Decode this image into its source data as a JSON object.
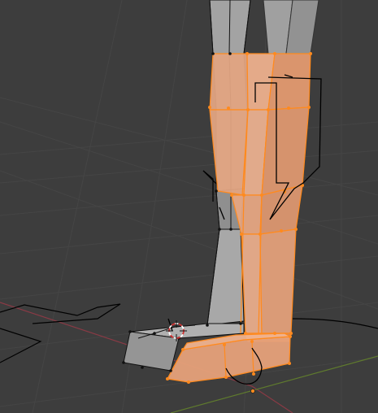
{
  "viewport": {
    "name": "3D Viewport",
    "colors": {
      "background": "#3d3d3d",
      "grid_line": "#454545",
      "axis_x": "#8a3a45",
      "axis_y": "#5f7a2e",
      "mesh_unselected_face": "#9c9c9c",
      "mesh_unselected_edge": "#111111",
      "mesh_selected_face": "#e7a57f",
      "mesh_selected_edge": "#ff8a1e",
      "vertex_selected": "#ff8a1e",
      "armature_line": "#000000",
      "cursor_red": "#d23232",
      "cursor_white": "#ffffff"
    }
  }
}
